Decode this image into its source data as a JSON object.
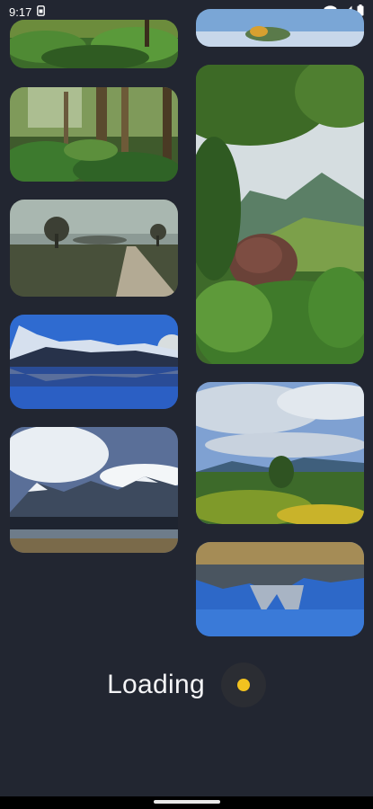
{
  "status_bar": {
    "time": "9:17",
    "icons": [
      "sim-card-icon",
      "wifi-icon",
      "signal-icon",
      "battery-icon"
    ]
  },
  "gallery": {
    "tiles": [
      {
        "name": "forest-undergrowth-photo",
        "column": "left"
      },
      {
        "name": "forest-ferns-photo",
        "column": "left"
      },
      {
        "name": "misty-field-road-photo",
        "column": "left"
      },
      {
        "name": "mountain-lake-reflection-photo",
        "column": "left"
      },
      {
        "name": "snowy-mountains-clouds-photo",
        "column": "left"
      },
      {
        "name": "blue-sky-partial-photo",
        "column": "right"
      },
      {
        "name": "jungle-hill-view-photo",
        "column": "right"
      },
      {
        "name": "cloudy-hills-photo",
        "column": "right"
      },
      {
        "name": "lake-reflection-photo",
        "column": "right"
      }
    ]
  },
  "loading": {
    "label": "Loading",
    "indicator_color": "#F2C21F"
  },
  "theme": {
    "background": "#222631",
    "accent": "#F2C21F"
  }
}
